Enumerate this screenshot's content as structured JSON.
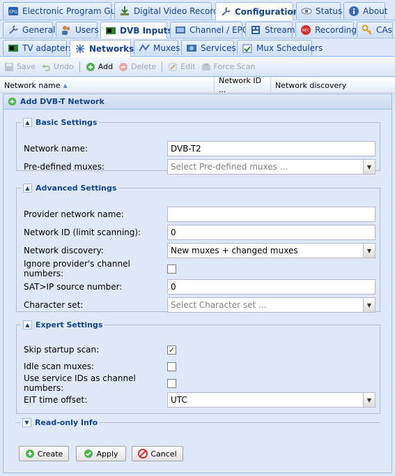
{
  "tabs_top": [
    {
      "label": "Electronic Program Guide",
      "icon": "epg-icon"
    },
    {
      "label": "Digital Video Recorder",
      "icon": "download-icon"
    },
    {
      "label": "Configuration",
      "icon": "wrench-icon",
      "active": true
    },
    {
      "label": "Status",
      "icon": "eye-icon"
    },
    {
      "label": "About",
      "icon": "info-icon"
    }
  ],
  "tabs_config": [
    {
      "label": "General",
      "icon": "wrench-icon"
    },
    {
      "label": "Users",
      "icon": "users-icon"
    },
    {
      "label": "DVB Inputs",
      "icon": "card-icon",
      "active": true
    },
    {
      "label": "Channel / EPG",
      "icon": "tv-icon"
    },
    {
      "label": "Stream",
      "icon": "stream-icon"
    },
    {
      "label": "Recording",
      "icon": "rec-icon"
    },
    {
      "label": "CAs",
      "icon": "key-icon"
    }
  ],
  "tabs_dvb": [
    {
      "label": "TV adapters",
      "icon": "card-icon"
    },
    {
      "label": "Networks",
      "icon": "network-icon",
      "active": true
    },
    {
      "label": "Muxes",
      "icon": "muxes-icon"
    },
    {
      "label": "Services",
      "icon": "services-icon"
    },
    {
      "label": "Mux Schedulers",
      "icon": "scheduler-icon"
    }
  ],
  "toolbar": {
    "save": "Save",
    "undo": "Undo",
    "add": "Add",
    "delete": "Delete",
    "edit": "Edit",
    "force_scan": "Force Scan"
  },
  "grid": {
    "col_name": "Network name",
    "col_id": "Network ID ...",
    "col_discovery": "Network discovery"
  },
  "panel": {
    "title": "Add DVB-T Network",
    "basic": {
      "legend": "Basic Settings",
      "network_name_label": "Network name:",
      "network_name_value": "DVB-T2",
      "predefined_label": "Pre-defined muxes:",
      "predefined_placeholder": "Select Pre-defined muxes ..."
    },
    "advanced": {
      "legend": "Advanced Settings",
      "provider_label": "Provider network name:",
      "provider_value": "",
      "netid_label": "Network ID (limit scanning):",
      "netid_value": "0",
      "discovery_label": "Network discovery:",
      "discovery_value": "New muxes + changed muxes",
      "ignore_label": "Ignore provider's channel numbers:",
      "ignore_checked": false,
      "satip_label": "SAT>IP source number:",
      "satip_value": "0",
      "charset_label": "Character set:",
      "charset_placeholder": "Select Character set ..."
    },
    "expert": {
      "legend": "Expert Settings",
      "skip_label": "Skip startup scan:",
      "skip_checked": true,
      "idle_label": "Idle scan muxes:",
      "idle_checked": false,
      "sid_label": "Use service IDs as channel numbers:",
      "sid_checked": false,
      "eit_label": "EIT time offset:",
      "eit_value": "UTC"
    },
    "readonly": {
      "legend": "Read-only Info"
    },
    "buttons": {
      "create": "Create",
      "apply": "Apply",
      "cancel": "Cancel"
    }
  },
  "colors": {
    "accent": "#15428b",
    "panel_bg": "#dfe8f6",
    "border": "#99bbe8"
  }
}
